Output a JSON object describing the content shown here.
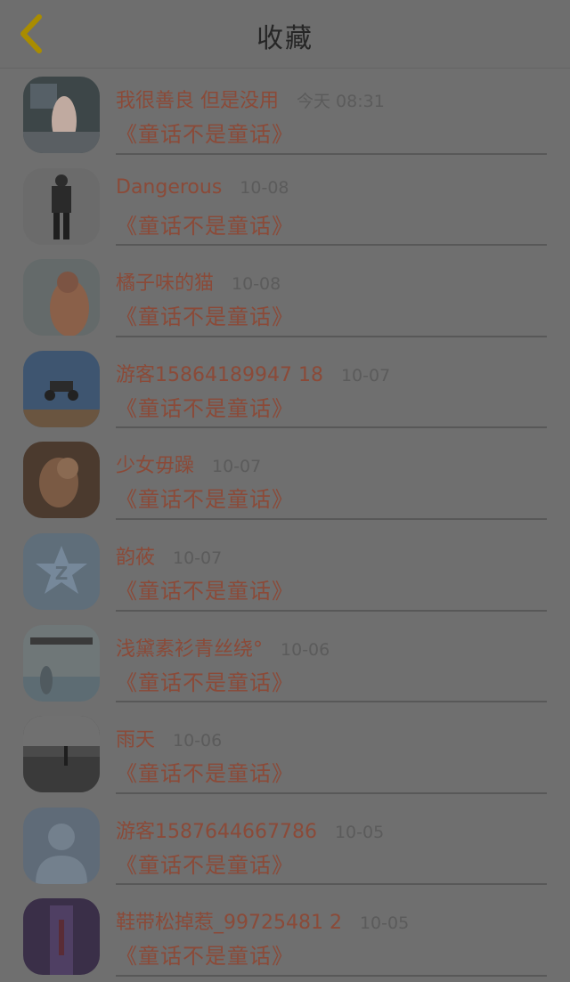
{
  "header": {
    "title": "收藏",
    "back_icon": "chevron-left-icon",
    "accent": "#c9a400"
  },
  "items": [
    {
      "name": "我很善良  但是没用",
      "time": "今天 08:31",
      "book": "《童话不是童话》",
      "avatar": "photo"
    },
    {
      "name": "Dangerous",
      "time": "10-08",
      "book": "《童话不是童话》",
      "avatar": "photo"
    },
    {
      "name": "橘子味的猫",
      "time": "10-08",
      "book": "《童话不是童话》",
      "avatar": "photo"
    },
    {
      "name": "游客15864189947 18",
      "time": "10-07",
      "book": "《童话不是童话》",
      "avatar": "photo"
    },
    {
      "name": "少女毋躁",
      "time": "10-07",
      "book": "《童话不是童话》",
      "avatar": "photo"
    },
    {
      "name": "韵莜",
      "time": "10-07",
      "book": "《童话不是童话》",
      "avatar": "default-star"
    },
    {
      "name": "浅黛素衫青丝绕°",
      "time": "10-06",
      "book": "《童话不是童话》",
      "avatar": "photo"
    },
    {
      "name": "雨天",
      "time": "10-06",
      "book": "《童话不是童话》",
      "avatar": "photo"
    },
    {
      "name": "游客1587644667786",
      "time": "10-05",
      "book": "《童话不是童话》",
      "avatar": "default-person"
    },
    {
      "name": "鞋带松掉惹_99725481 2",
      "time": "10-05",
      "book": "《童话不是童话》",
      "avatar": "photo"
    }
  ]
}
